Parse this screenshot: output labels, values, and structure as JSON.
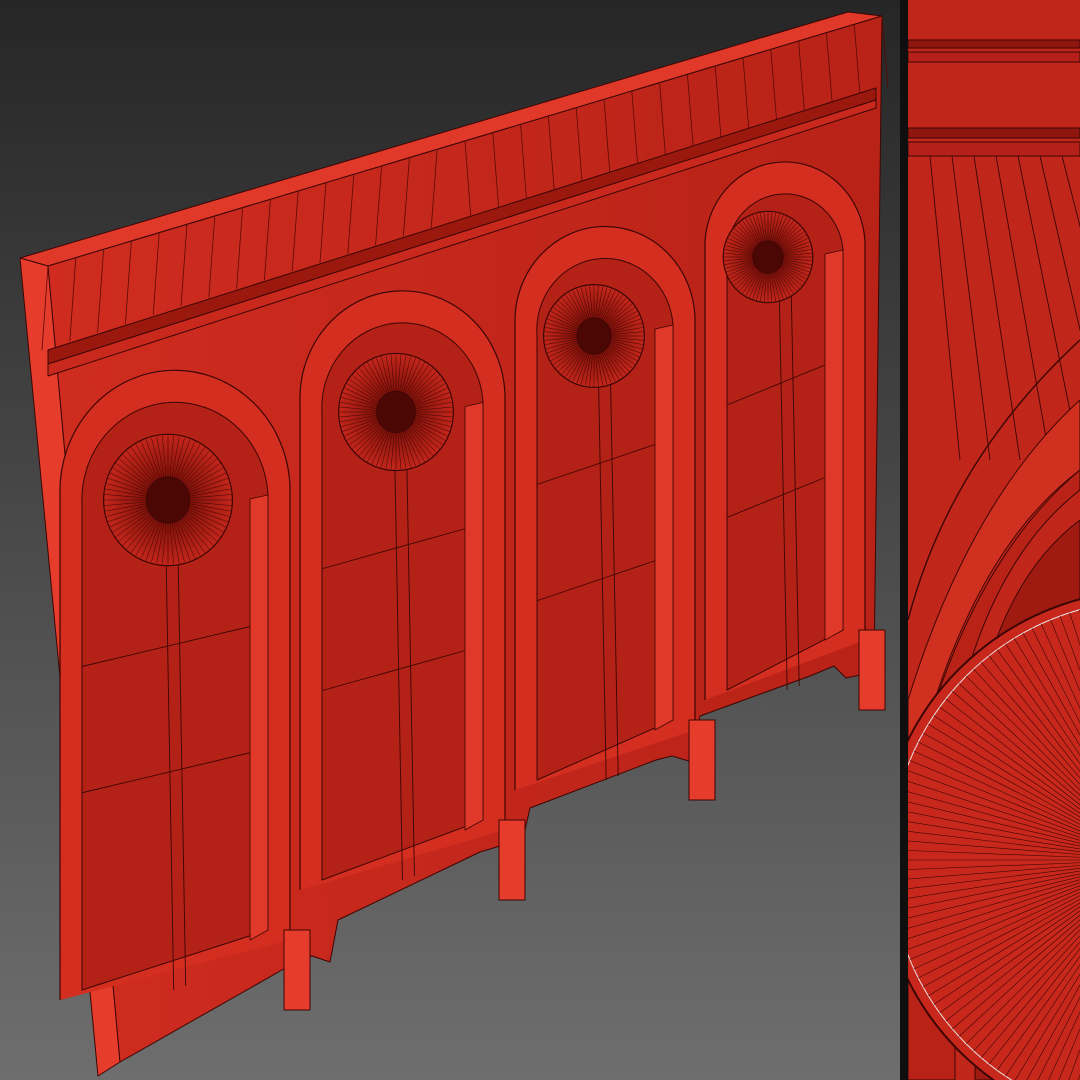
{
  "image": {
    "subject": "arched-wall-panel-wireframe-render",
    "layout": "main-view-with-closeup-inset",
    "colors": {
      "model_fill": "#c4261b",
      "model_light": "#e0392a",
      "model_dark": "#8f160e",
      "wire_lines": "#3d0604",
      "background_top": "#262626",
      "background_bottom": "#6e6e6e",
      "divider": "#0f0f0f"
    },
    "arch_count": 4,
    "rosette_count": 4
  }
}
